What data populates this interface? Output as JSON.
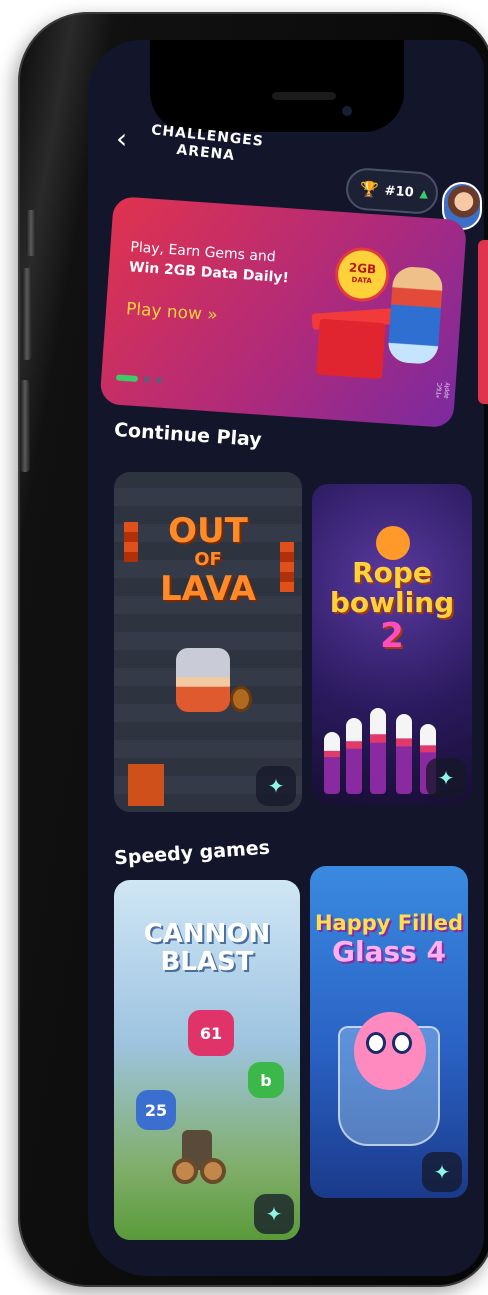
{
  "header": {
    "back_icon": "chevron-left-icon",
    "logo_line1": "CHALLENGES",
    "logo_line2": "ARENA",
    "rank": "#10",
    "rank_icon": "trophy-icon",
    "trend_icon": "arrow-up-icon"
  },
  "banner": {
    "line1": "Play, Earn Gems and",
    "line2": "Win 2GB Data Daily!",
    "cta": "Play now »",
    "badge_amount": "2GB",
    "badge_unit": "DATA",
    "tnc": "*T&C apply",
    "carousel_total": 3,
    "carousel_active": 1
  },
  "sections": {
    "continue_play": {
      "title": "Continue Play",
      "games": [
        {
          "title_line1": "OUT",
          "title_line2": "OF",
          "title_line3": "LAVA"
        },
        {
          "title_line1": "Rope",
          "title_line2": "bowling",
          "title_line3": "2"
        }
      ]
    },
    "speedy_games": {
      "title": "Speedy games",
      "games": [
        {
          "title_line1": "CANNON",
          "title_line2": "BLAST",
          "numbers": [
            "61",
            "b",
            "25"
          ]
        },
        {
          "title_line1": "Happy Filled",
          "title_line2": "Glass 4"
        }
      ]
    }
  },
  "icons": {
    "gem": "gem-icon"
  },
  "colors": {
    "background": "#13162a",
    "accent_green": "#3ccc66",
    "cta_yellow": "#ffd23a",
    "banner_red": "#e0334e"
  }
}
